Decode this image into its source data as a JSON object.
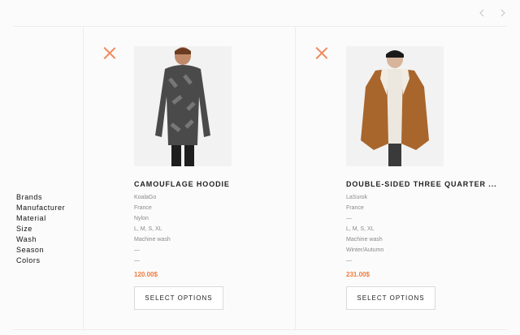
{
  "pager": {
    "prev_icon": "chevron-left-icon",
    "next_icon": "chevron-right-icon"
  },
  "attribute_labels": [
    "Brands",
    "Manufacturer",
    "Material",
    "Size",
    "Wash",
    "Season",
    "Colors"
  ],
  "products": [
    {
      "title": "CAMOUFLAGE HOODIE",
      "specs": [
        "KoalaGo",
        "France",
        "Nylon",
        "L, M, S, XL",
        "Machine wash",
        "—",
        "—"
      ],
      "price": "120.00$",
      "button_label": "SELECT OPTIONS"
    },
    {
      "title": "DOUBLE-SIDED THREE QUARTER ...",
      "specs": [
        "LaSurok",
        "France",
        "—",
        "L, M, S, XL",
        "Machine wash",
        "Winter/Autumn",
        "—"
      ],
      "price": "231.00$",
      "button_label": "SELECT OPTIONS"
    }
  ],
  "colors": {
    "accent": "#f07a3c",
    "remove_icon": "#f08a5d",
    "border": "#ececec"
  }
}
